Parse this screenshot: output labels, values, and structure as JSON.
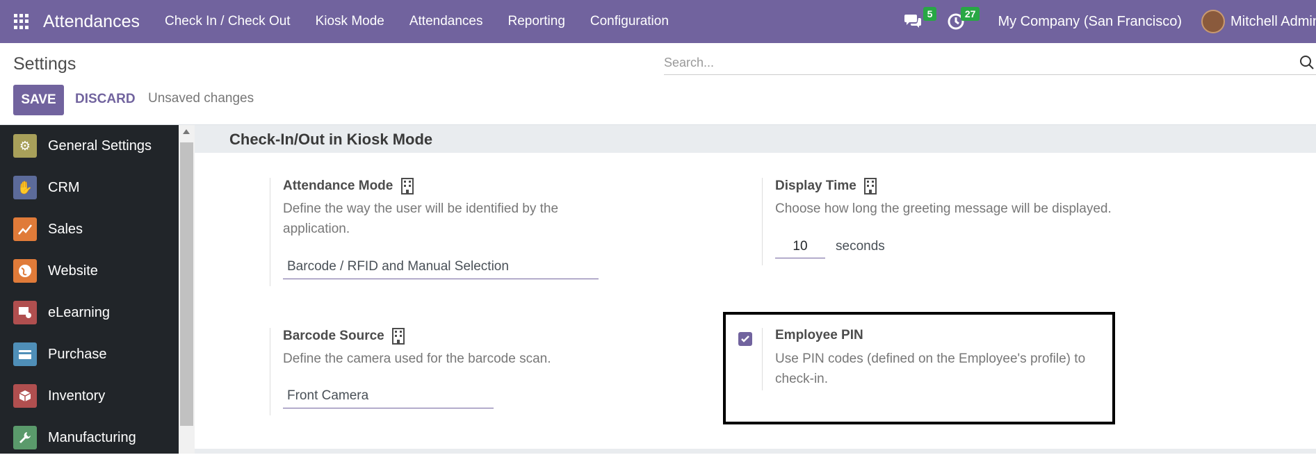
{
  "navbar": {
    "app_title": "Attendances",
    "menu": [
      "Check In / Check Out",
      "Kiosk Mode",
      "Attendances",
      "Reporting",
      "Configuration"
    ],
    "messages_count": "5",
    "activities_count": "27",
    "company": "My Company (San Francisco)",
    "user": "Mitchell Admin"
  },
  "control": {
    "title": "Settings",
    "search_placeholder": "Search...",
    "save_label": "SAVE",
    "discard_label": "DISCARD",
    "status": "Unsaved changes"
  },
  "sidebar": {
    "items": [
      {
        "label": "General Settings",
        "icon": "gear-icon",
        "color": "#a8a05a"
      },
      {
        "label": "CRM",
        "icon": "handshake-icon",
        "color": "#5c6b9a"
      },
      {
        "label": "Sales",
        "icon": "chart-icon",
        "color": "#e07b39"
      },
      {
        "label": "Website",
        "icon": "globe-icon",
        "color": "#e07b39"
      },
      {
        "label": "eLearning",
        "icon": "elearning-icon",
        "color": "#b04f4f"
      },
      {
        "label": "Purchase",
        "icon": "card-icon",
        "color": "#4f8fb8"
      },
      {
        "label": "Inventory",
        "icon": "box-icon",
        "color": "#b04f4f"
      },
      {
        "label": "Manufacturing",
        "icon": "wrench-icon",
        "color": "#5a9a6b"
      }
    ]
  },
  "content": {
    "section_title": "Check-In/Out in Kiosk Mode",
    "attendance_mode": {
      "title": "Attendance Mode",
      "desc_line1": "Define the way the user will be identified by the",
      "desc_line2": "application.",
      "value": "Barcode / RFID and Manual Selection"
    },
    "display_time": {
      "title": "Display Time",
      "desc": "Choose how long the greeting message will be displayed.",
      "value": "10",
      "unit": "seconds"
    },
    "barcode_source": {
      "title": "Barcode Source",
      "desc": "Define the camera used for the barcode scan.",
      "value": "Front Camera"
    },
    "employee_pin": {
      "title": "Employee PIN",
      "desc_line1": "Use PIN codes (defined on the Employee's profile) to",
      "desc_line2": "check-in.",
      "checked": true
    }
  },
  "colors": {
    "brand": "#71639e",
    "sidebar_bg": "#212529",
    "badge": "#28a745"
  }
}
